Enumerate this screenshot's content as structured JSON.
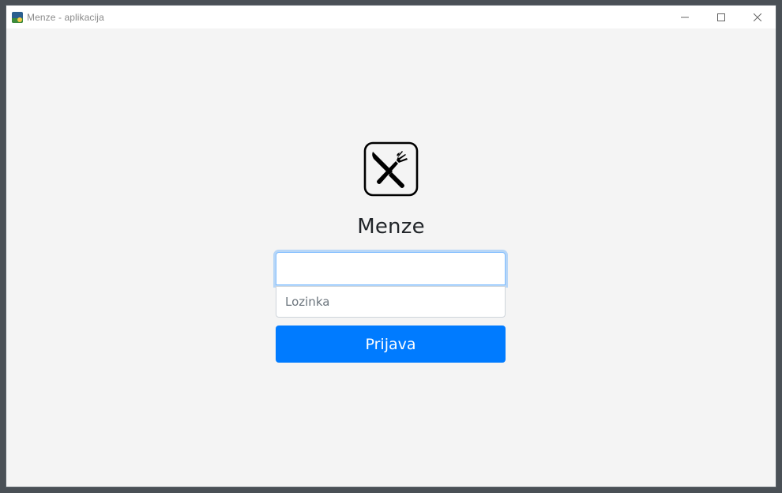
{
  "window": {
    "title": "Menze - aplikacija",
    "app_icon": "python-app-icon"
  },
  "controls": {
    "minimize": "minimize-icon",
    "maximize": "maximize-icon",
    "close": "close-icon"
  },
  "login": {
    "logo_icon": "fork-knife-icon",
    "heading": "Menze",
    "username_value": "",
    "username_placeholder": "",
    "password_placeholder": "Lozinka",
    "submit_label": "Prijava"
  },
  "colors": {
    "accent": "#007bff",
    "focus": "#80bdff",
    "background": "#f4f4f4"
  }
}
